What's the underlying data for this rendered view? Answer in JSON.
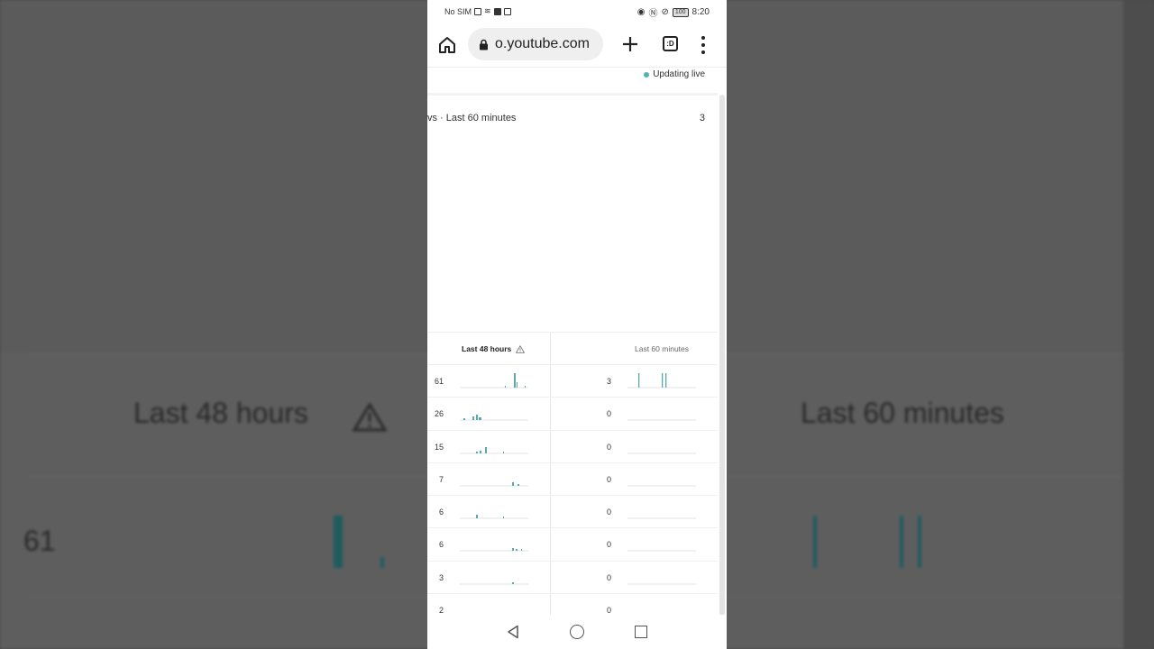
{
  "status_bar": {
    "carrier": "No SIM",
    "battery": "100",
    "time": "8:20"
  },
  "browser": {
    "url": "o.youtube.com",
    "tabs_count": ":D"
  },
  "live_status": "Updating live",
  "metric": {
    "title": "vs · Last 60 minutes",
    "value": "3"
  },
  "table": {
    "headers": {
      "last_48": "Last 48 hours",
      "last_60": "Last 60 minutes"
    },
    "rows": [
      {
        "v48": "61",
        "v60": "3"
      },
      {
        "v48": "26",
        "v60": "0"
      },
      {
        "v48": "15",
        "v60": "0"
      },
      {
        "v48": "7",
        "v60": "0"
      },
      {
        "v48": "6",
        "v60": "0"
      },
      {
        "v48": "6",
        "v60": "0"
      },
      {
        "v48": "3",
        "v60": "0"
      },
      {
        "v48": "2",
        "v60": "0"
      }
    ]
  },
  "background": {
    "h48": "Last 48 hours",
    "h60": "Last 60 minutes",
    "v48": "61"
  },
  "colors": {
    "accent": "#4db6ac",
    "spark": "#5aa9b0"
  }
}
